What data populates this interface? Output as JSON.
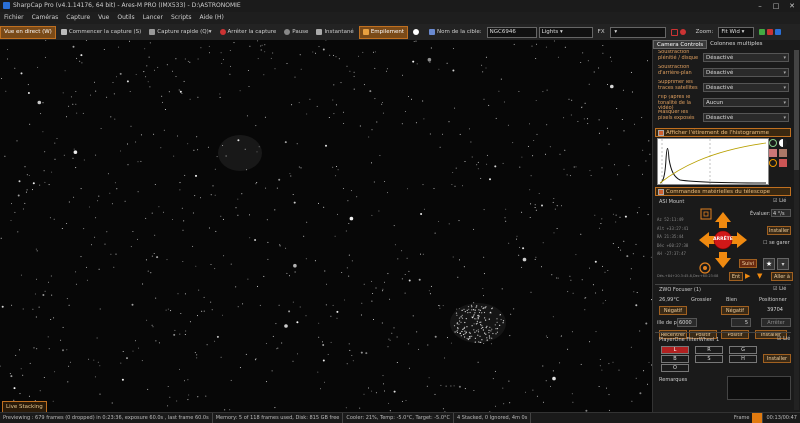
{
  "window": {
    "title": "SharpCap Pro (v4.1.14176, 64 bit) - Ares-M PRO (IMX533) - D:\\ASTRONOMIE",
    "controls": [
      "–",
      "□",
      "✕"
    ]
  },
  "menu": [
    "Fichier",
    "Caméras",
    "Capture",
    "Vue",
    "Outils",
    "Lancer",
    "Scripts",
    "Aide (H)"
  ],
  "toolbar": {
    "live_view": "Vue en direct (W)",
    "start_capture": "Commencer la capture (S)",
    "quick_capture": "Capture rapide (Q)",
    "stop_capture": "Arrêter la capture",
    "pause": "Pause",
    "snapshot": "Instantané",
    "stacking": "Empilement",
    "target_label": "Nom de la cible:",
    "target_value": "NGC6946",
    "frame_type": "Lights",
    "fx_label": "FX",
    "zoom_label": "Zoom:",
    "zoom_value": "Fit Wid"
  },
  "live_stacking_label": "Live Stacking",
  "status": {
    "preview": "Previewing : 679 frames (0 dropped) in 0:23:36, exposure 60.0s , last frame 60.0s",
    "memory": "Memory: 5 of 118 frames used, Disk: 815 GB free",
    "cooler": "Cooler: 21%, Temp: -5.0°C, Target: -5.0°C",
    "stack": "4 Stacked, 0 Ignored, 4m 0s",
    "frame_label": "Frame",
    "elapsed": "00:13/00:47"
  },
  "panel": {
    "tabs": [
      "Camera Controls",
      "Colonnes multiples"
    ],
    "settings": [
      {
        "label": "Soustraction plénitié / disque",
        "value": "Désactivé"
      },
      {
        "label": "Soustraction d'arrière-plan",
        "value": "Désactivé"
      },
      {
        "label": "Supprimer les traces satellites",
        "value": "Désactivé"
      },
      {
        "label": "Flip (après le tonalité de la vidéo)",
        "value": "Aucun"
      },
      {
        "label": "Masquer les pixels exposés",
        "value": "Désactivé"
      }
    ],
    "histogram_header": "Afficher l'étirement de l'histogramme",
    "telescope_header": "Commandes matérielles du télescope",
    "mount": {
      "name": "ASI Mount",
      "connected": "Lié",
      "evaluate_label": "Évaluer:",
      "rate": "4 °/s",
      "install": "Installer",
      "stop": "ARRÊTE",
      "follow": "Suivi",
      "park": "Aller à",
      "goto": "Ent",
      "coords": [
        "Az   52:11:49",
        "Alt  +33:27:41",
        "RA   21:35:44",
        "Déc  +60:27:38",
        "AH   -27:37:47"
      ],
      "status_line": "Dés.+84+20.3:45.8,Dec+60:23:08",
      "side_label": "se garer"
    },
    "focuser": {
      "name": "ZWO Focuser (1)",
      "connected": "Lié",
      "temp": "26,99°C",
      "coarse": "Grossier",
      "fine": "Bien",
      "position_label": "Positionner",
      "negative": "Négatif",
      "positive": "Positif",
      "position": "39704",
      "step_label": "ille de pas",
      "step1": "6000",
      "step2": "5",
      "stop": "Arrêter",
      "recenter": "Recentrer",
      "install": "Installer"
    },
    "filterwheel": {
      "name": "PlayerOne FilterWheel 1",
      "connected": "Lié",
      "filters": [
        "L",
        "R",
        "G",
        "B",
        "S",
        "H",
        "O"
      ],
      "selected": "L",
      "install": "Installer"
    },
    "remarks_label": "Remarques"
  },
  "colors": {
    "accent": "#c07020",
    "stop": "#d01818",
    "arrow": "#f08a10"
  }
}
